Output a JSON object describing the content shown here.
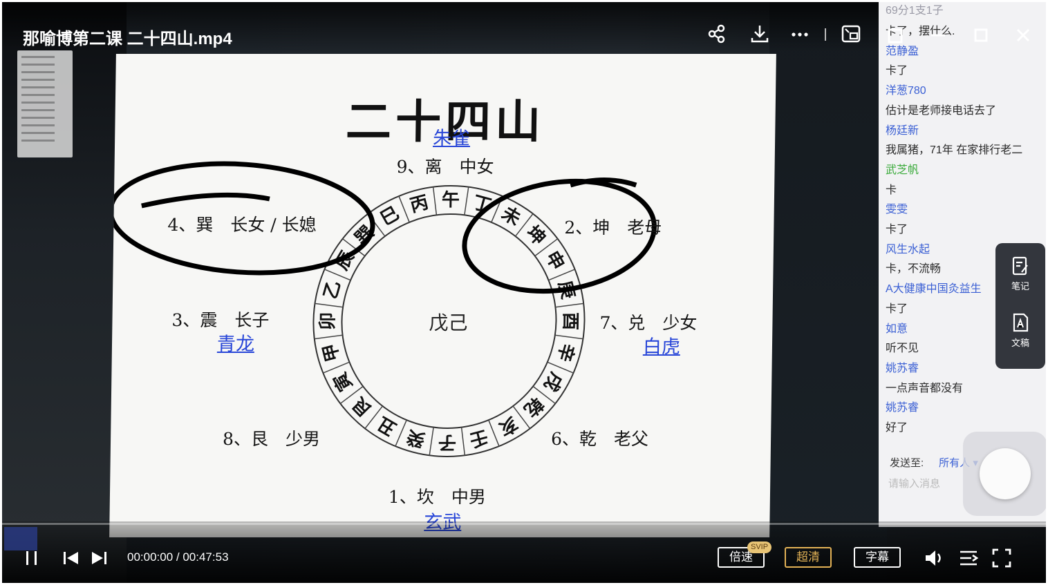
{
  "window": {
    "title": "那喻博第二课 二十四山.mp4"
  },
  "slide": {
    "title": "二十四山",
    "center": "戊己",
    "directions": {
      "north": "玄武",
      "south": "朱雀",
      "east": "青龙",
      "west": "白虎"
    },
    "trigrams": [
      "9、离　中女",
      "4、巽　长女 / 长媳",
      "2、坤　老母",
      "3、震　长子",
      "7、兑　少女",
      "8、艮　少男",
      "6、乾　老父",
      "1、坎　中男"
    ],
    "ring_chars": [
      "午",
      "丁",
      "未",
      "坤",
      "申",
      "庚",
      "酉",
      "辛",
      "戌",
      "乾",
      "亥",
      "壬",
      "子",
      "癸",
      "丑",
      "艮",
      "寅",
      "甲",
      "卯",
      "乙",
      "辰",
      "巽",
      "巳",
      "丙"
    ]
  },
  "chat": {
    "top_snippet": "69分1支1子",
    "messages": [
      {
        "type": "m",
        "text": "卡了，摆什么."
      },
      {
        "type": "u",
        "text": "范静盈"
      },
      {
        "type": "m",
        "text": "卡了"
      },
      {
        "type": "u",
        "text": "洋葱780"
      },
      {
        "type": "m",
        "text": "估计是老师接电话去了"
      },
      {
        "type": "u",
        "text": "杨廷新"
      },
      {
        "type": "m",
        "text": "我属猪，71年 在家排行老二"
      },
      {
        "type": "g",
        "text": "武芝帆"
      },
      {
        "type": "m",
        "text": "卡"
      },
      {
        "type": "u",
        "text": "雯雯"
      },
      {
        "type": "m",
        "text": "卡了"
      },
      {
        "type": "u",
        "text": "风生水起"
      },
      {
        "type": "m",
        "text": "卡，不流畅"
      },
      {
        "type": "u",
        "text": "A大健康中国灸益生"
      },
      {
        "type": "m",
        "text": "卡了"
      },
      {
        "type": "u",
        "text": "如意"
      },
      {
        "type": "m",
        "text": "听不见"
      },
      {
        "type": "u",
        "text": "姚苏睿"
      },
      {
        "type": "m",
        "text": "一点声音都没有"
      },
      {
        "type": "u",
        "text": "姚苏睿"
      },
      {
        "type": "m",
        "text": "好了"
      }
    ],
    "send_to_label": "发送至:",
    "send_to_value": "所有人",
    "input_placeholder": "请输入消息"
  },
  "side_tools": {
    "notes": "笔记",
    "transcript": "文稿"
  },
  "player": {
    "time": "00:00:00 / 00:47:53",
    "progress": 0,
    "speed_label": "倍速",
    "svip_badge": "SVIP",
    "quality_label": "超清",
    "subtitle_label": "字幕"
  },
  "icons": [
    "share-icon",
    "download-icon",
    "more-icon",
    "pip-icon",
    "minimize-icon",
    "maximize-icon",
    "close-icon",
    "pause-icon",
    "prev-icon",
    "next-icon",
    "volume-icon",
    "playlist-icon",
    "fullscreen-icon",
    "note-icon",
    "transcript-icon"
  ],
  "colors": {
    "link_blue": "#2846d8",
    "gold": "#e3b256"
  }
}
